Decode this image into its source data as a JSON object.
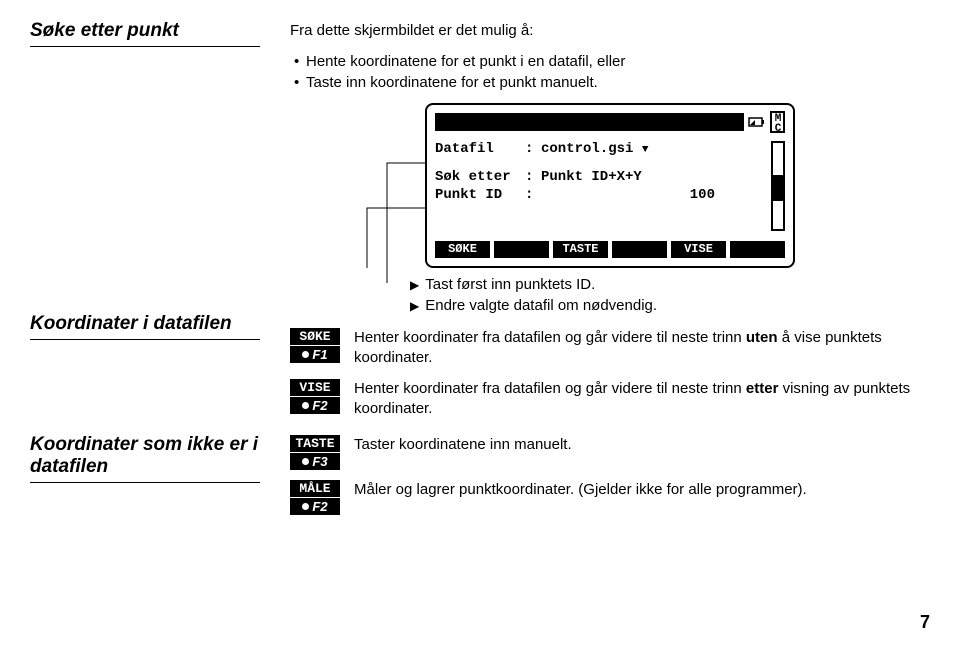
{
  "heading_main": "Søke etter punkt",
  "intro": "Fra dette skjermbildet er det mulig å:",
  "bullets": [
    "Hente koordinatene for et punkt i en datafil, eller",
    "Taste inn koordinatene for et punkt manuelt."
  ],
  "device": {
    "mc": "MC",
    "rows": {
      "datafil_label": "Datafil",
      "datafil_value": "control.gsi",
      "sok_label": "Søk etter",
      "sok_value": "Punkt ID+X+Y",
      "punktid_label": "Punkt ID",
      "punktid_value": "100"
    },
    "softkeys": [
      "SØKE",
      "",
      "TASTE",
      "",
      "VISE",
      ""
    ]
  },
  "notes": [
    "Tast først inn punktets ID.",
    "Endre valgte datafil om nødvendig."
  ],
  "section2_heading": "Koordinater i datafilen",
  "section2_rows": [
    {
      "key_top": "SØKE",
      "key_bot": "F1",
      "text_before": "Henter koordinater fra datafilen og går videre til neste trinn ",
      "text_bold": "uten",
      "text_after": " å vise punktets koordinater."
    },
    {
      "key_top": "VISE",
      "key_bot": "F2",
      "text_before": "Henter koordinater fra datafilen og går videre til neste trinn ",
      "text_bold": "etter",
      "text_after": " visning av punktets koordinater."
    }
  ],
  "section3_heading": "Koordinater som ikke er i datafilen",
  "section3_rows": [
    {
      "key_top": "TASTE",
      "key_bot": "F3",
      "text": "Taster koordinatene inn manuelt."
    },
    {
      "key_top": "MÅLE",
      "key_bot": "F2",
      "text": "Måler og lagrer punktkoordinater. (Gjelder ikke for alle programmer)."
    }
  ],
  "page_number": "7"
}
